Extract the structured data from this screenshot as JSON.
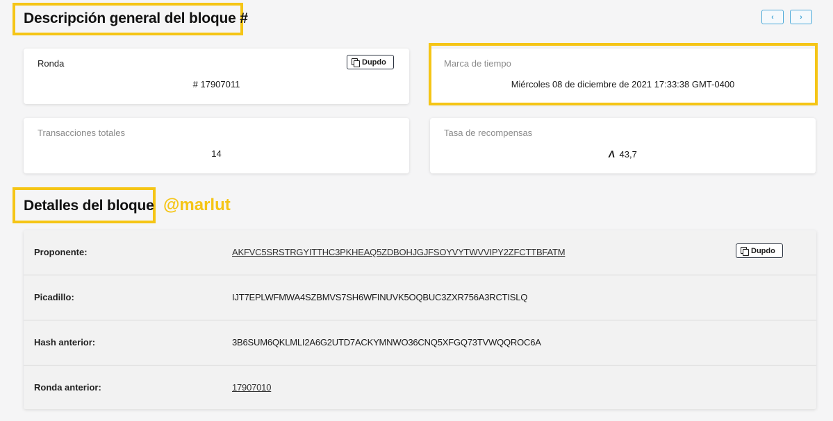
{
  "overview": {
    "title": "Descripción general del bloque #",
    "nav_prev": "‹",
    "nav_next": "›"
  },
  "cards": {
    "round": {
      "label": "Ronda",
      "value": "# 17907011",
      "copy_label": "Dupdo"
    },
    "timestamp": {
      "label": "Marca de tiempo",
      "value": "Miércoles 08 de diciembre de 2021 17:33:38 GMT-0400"
    },
    "transactions": {
      "label": "Transacciones totales",
      "value": "14"
    },
    "rewards": {
      "label": "Tasa de recompensas",
      "value": "43,7",
      "icon": "algorand-icon"
    }
  },
  "details": {
    "title": "Detalles del bloque",
    "watermark": "@marlut",
    "rows": [
      {
        "label": "Proponente:",
        "value": "AKFVC5SRSTRGYITTHC3PKHEAQ5ZDBOHJGJFSOYVYTWVVIPY2ZFCTTBFATM",
        "copy_label": "Dupdo"
      },
      {
        "label": "Picadillo:",
        "value": "IJT7EPLWFMWA4SZBMVS7SH6WFINUVK5OQBUC3ZXR756A3RCTISLQ"
      },
      {
        "label": "Hash anterior:",
        "value": "3B6SUM6QKLMLI2A6G2UTD7ACKYMNWO36CNQ5XFGQ73TVWQQROC6A"
      },
      {
        "label": "Ronda anterior:",
        "value": "17907010"
      }
    ]
  },
  "colors": {
    "highlight": "#f5c516",
    "accent": "#4aa8d8"
  }
}
